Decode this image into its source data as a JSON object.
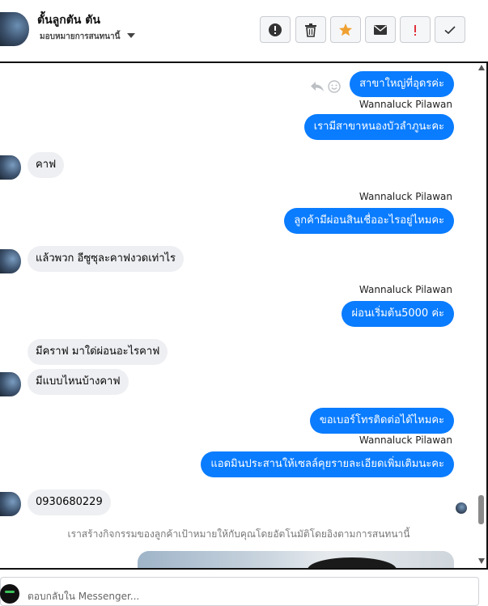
{
  "header": {
    "contact_name": "ตั้นลูกตัน ตัน",
    "subtitle": "มอบหมายการสนทนานี้",
    "actions": [
      {
        "name": "alert-icon"
      },
      {
        "name": "trash-icon"
      },
      {
        "name": "star-icon",
        "color": "#f0a030"
      },
      {
        "name": "envelope-icon"
      },
      {
        "name": "exclamation-icon",
        "color": "#e0303a"
      },
      {
        "name": "checkmark-icon"
      }
    ]
  },
  "colors": {
    "outgoing_bubble": "#0a7cff",
    "incoming_bubble": "#eeeff2"
  },
  "messages": [
    {
      "direction": "out",
      "text": "สาขาใหญ่ที่อุดรค่ะ"
    },
    {
      "sender": "Wannaluck Pilawan",
      "direction": "out",
      "text": "เรามีสาขาหนองบัวลำภูนะคะ"
    },
    {
      "direction": "in",
      "text": "คาฟ"
    },
    {
      "sender": "Wannaluck Pilawan",
      "direction": "out",
      "text": "ลูกค้ามีผ่อนสินเชื่ออะไรอยู่ไหมคะ"
    },
    {
      "direction": "in",
      "text": "แล้วพวก อีซูซุละคาฟงวดเท่าไร"
    },
    {
      "sender": "Wannaluck Pilawan",
      "direction": "out",
      "text": "ผ่อนเริ่มต้น5000 ค่ะ"
    },
    {
      "direction": "in",
      "text": "มีคราฟ มาใด่ผ่อนอะไรคาฟ"
    },
    {
      "direction": "in",
      "text": "มีแบบไหนบ้างคาฟ"
    },
    {
      "direction": "out",
      "text": "ขอเบอร์โทรติดต่อได้ไหมคะ"
    },
    {
      "sender": "Wannaluck Pilawan",
      "direction": "out",
      "text": "แอดมินประสานให้เซลล์คุยรายละเอียดเพิ่มเติมนะคะ"
    },
    {
      "direction": "in",
      "text": "0930680229"
    }
  ],
  "notice": "เราสร้างกิจกรรมของลูกค้าเป้าหมายให้กับคุณโดยอัตโนมัติโดยอิงตามการสนทนานี้",
  "composer": {
    "placeholder": "ตอบกลับใน Messenger..."
  }
}
